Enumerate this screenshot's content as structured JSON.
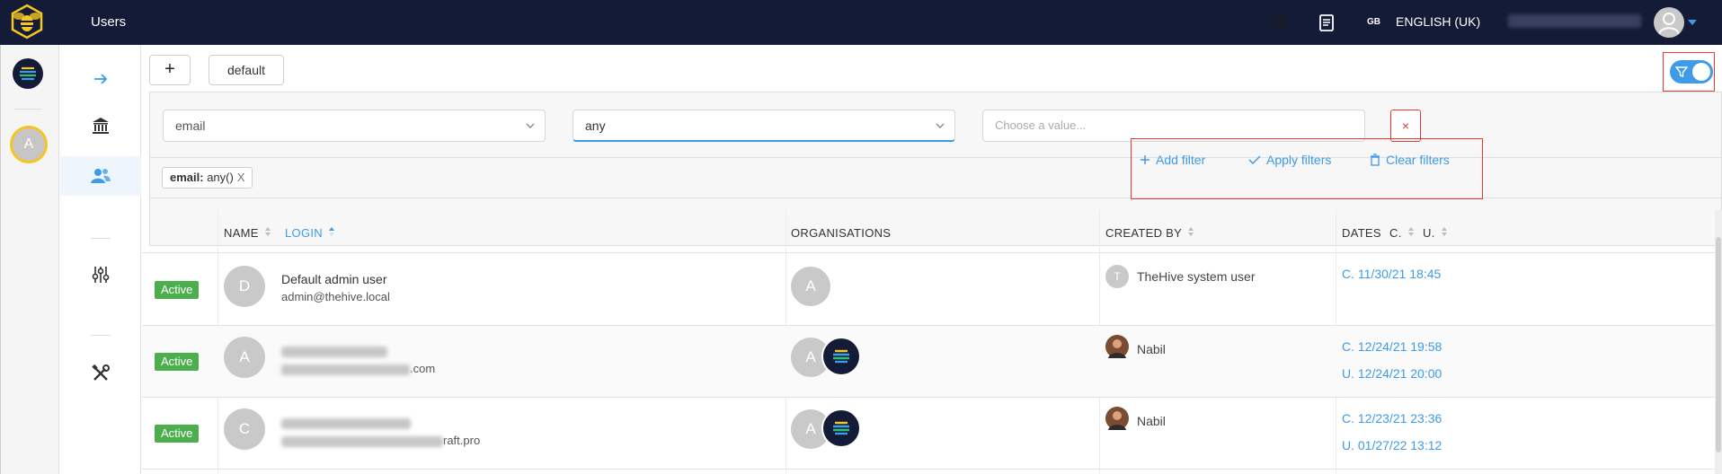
{
  "header": {
    "title": "Users",
    "language_flag": "GB",
    "language": "ENGLISH (UK)"
  },
  "rail": {
    "user_initial": "A"
  },
  "toolbar": {
    "add_label": "+",
    "preset_label": "default"
  },
  "filters": {
    "field_value": "email",
    "operator_value": "any",
    "value_placeholder": "Choose a value...",
    "remove_label": "×",
    "active_tag_field": "email:",
    "active_tag_value": " any()",
    "active_tag_remove": "X",
    "add_filter_label": "Add filter",
    "apply_filters_label": "Apply filters",
    "clear_filters_label": "Clear filters"
  },
  "table": {
    "columns": {
      "name": "NAME",
      "login": "LOGIN",
      "organisations": "ORGANISATIONS",
      "created_by": "CREATED BY",
      "dates": "DATES",
      "dates_c": "C.",
      "dates_u": "U."
    },
    "rows": [
      {
        "status": "Active",
        "initial": "D",
        "name": "Default admin user",
        "login": "admin@thehive.local",
        "org_initial": "A",
        "created_by_initial": "T",
        "created_by": "TheHive system user",
        "created": "C. 11/30/21 18:45",
        "updated": ""
      },
      {
        "status": "Active",
        "initial": "A",
        "name": "",
        "login": ".com",
        "org_initial": "A",
        "created_by_initial": "",
        "created_by": "Nabil",
        "created": "C. 12/24/21 19:58",
        "updated": "U. 12/24/21 20:00"
      },
      {
        "status": "Active",
        "initial": "C",
        "name": "",
        "login": "raft.pro",
        "org_initial": "A",
        "created_by_initial": "",
        "created_by": "Nabil",
        "created": "C. 12/23/21 23:36",
        "updated": "U. 01/27/22 13:12"
      }
    ]
  },
  "colors": {
    "topbar": "#141b36",
    "accent": "#3d9be9",
    "active_badge": "#4cae4c",
    "highlight_frame": "#e53935"
  }
}
